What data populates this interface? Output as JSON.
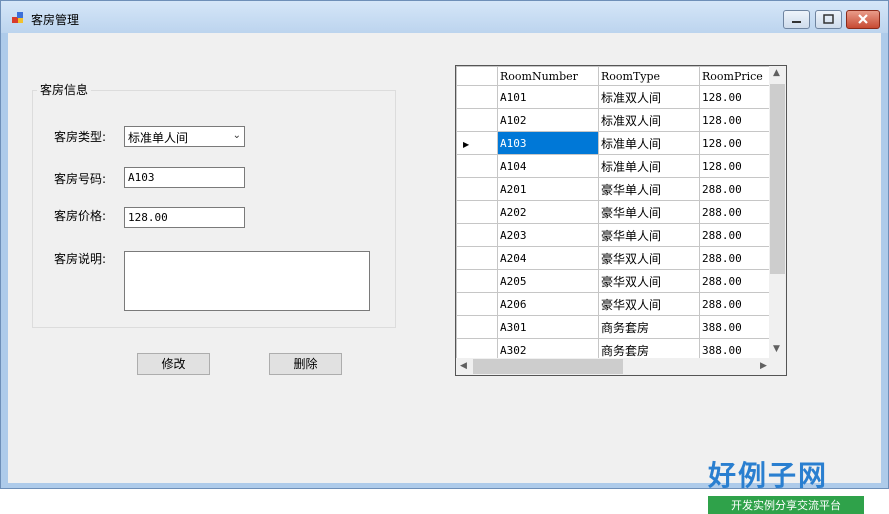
{
  "window": {
    "title": "客房管理"
  },
  "form": {
    "group_title": "客房信息",
    "type_label": "客房类型:",
    "type_value": "标准单人间",
    "number_label": "客房号码:",
    "number_value": "A103",
    "price_label": "客房价格:",
    "price_value": "128.00",
    "desc_label": "客房说明:",
    "desc_value": ""
  },
  "buttons": {
    "modify": "修改",
    "delete": "删除"
  },
  "grid": {
    "columns": [
      "RoomNumber",
      "RoomType",
      "RoomPrice"
    ],
    "rows": [
      [
        "A101",
        "标准双人间",
        "128.00"
      ],
      [
        "A102",
        "标准双人间",
        "128.00"
      ],
      [
        "A103",
        "标准单人间",
        "128.00"
      ],
      [
        "A104",
        "标准单人间",
        "128.00"
      ],
      [
        "A201",
        "豪华单人间",
        "288.00"
      ],
      [
        "A202",
        "豪华单人间",
        "288.00"
      ],
      [
        "A203",
        "豪华单人间",
        "288.00"
      ],
      [
        "A204",
        "豪华双人间",
        "288.00"
      ],
      [
        "A205",
        "豪华双人间",
        "288.00"
      ],
      [
        "A206",
        "豪华双人间",
        "288.00"
      ],
      [
        "A301",
        "商务套房",
        "388.00"
      ],
      [
        "A302",
        "商务套房",
        "388.00"
      ]
    ],
    "selected_row": 2
  },
  "watermark": {
    "main": "好例子网",
    "sub": "开发实例分享交流平台"
  }
}
